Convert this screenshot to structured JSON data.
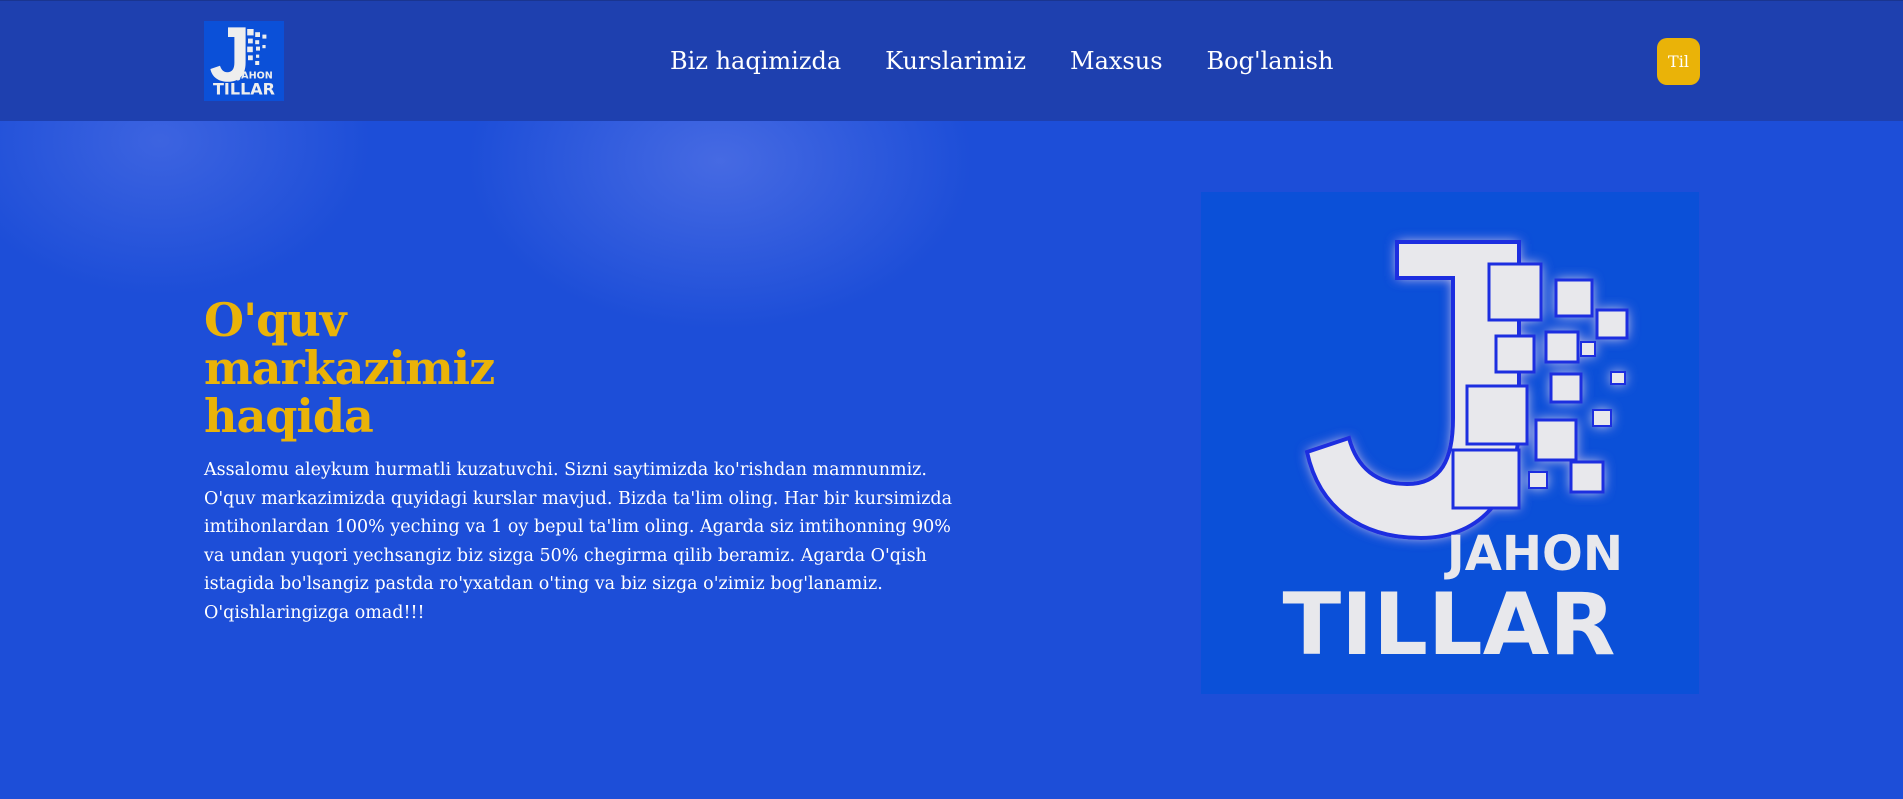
{
  "header": {
    "logo": {
      "icon": "jahon-tillar-logo",
      "line1": "JAHON",
      "line2": "TILLAR"
    },
    "nav": [
      {
        "label": "Biz haqimizda"
      },
      {
        "label": "Kurslarimiz"
      },
      {
        "label": "Maxsus"
      },
      {
        "label": "Bog'lanish"
      }
    ],
    "language_button": "Til"
  },
  "hero": {
    "title": "O'quv markazimiz haqida",
    "text": "Assalomu aleykum hurmatli kuzatuvchi. Sizni saytimizda ko'rishdan mamnunmiz. O'quv markazimizda quyidagi kurslar mavjud. Bizda ta'lim oling. Har bir kursimizda imtihonlardan 100% yeching va 1 oy bepul ta'lim oling. Agarda siz imtihonning 90% va undan yuqori yechsangiz biz sizga 50% chegirma qilib beramiz. Agarda O'qish istagida bo'lsangiz pastda ro'yxatdan o'ting va biz sizga o'zimiz bog'lanamiz. O'qishlaringizga omad!!!",
    "logo": {
      "icon": "jahon-tillar-logo",
      "line1": "JAHON",
      "line2": "TILLAR"
    }
  },
  "colors": {
    "background": "#1d4ed8",
    "header": "#1e40af",
    "accent": "#eab308",
    "logo_background": "#0b50d8"
  }
}
